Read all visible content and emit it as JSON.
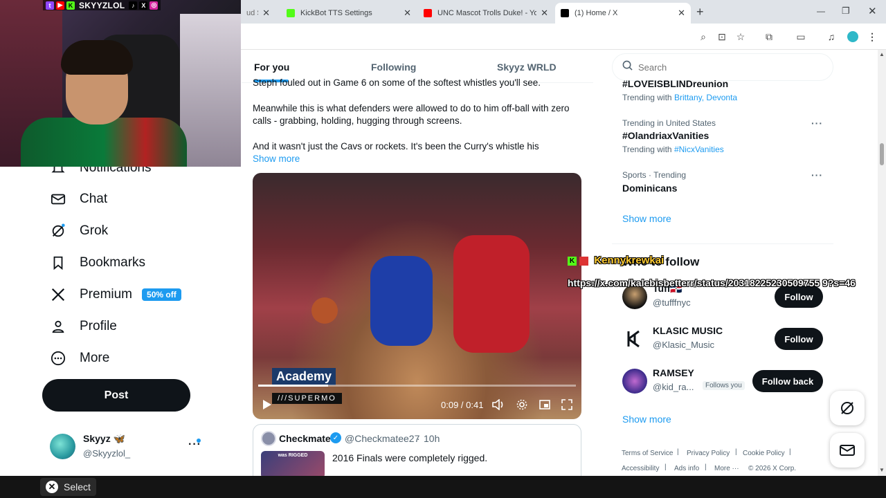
{
  "browser": {
    "tabs": [
      {
        "title": "ud St",
        "active": false,
        "color": "#6b6b6b"
      },
      {
        "title": "KickBot TTS Settings",
        "active": false,
        "color": "#53fc18"
      },
      {
        "title": "UNC Mascot Trolls Duke! - YouTube",
        "active": false,
        "color": "#ff0000"
      },
      {
        "title": "(1) Home / X",
        "active": true,
        "color": "#000000"
      }
    ],
    "new_tab_label": "+",
    "toolbar_icons": [
      "zoom-icon",
      "install-icon",
      "bookmark-star-icon",
      "extensions-icon",
      "cast-icon",
      "media-controls-icon",
      "profile-icon",
      "kebab-menu-icon"
    ]
  },
  "overlay": {
    "handle": "SKYYZLOL",
    "tts_user": "Kennykrewkai",
    "tts_message": "https://x.com/kalebisbetterr/status/20318225230509755 9?s=46"
  },
  "nav": {
    "notifications": "Notifications",
    "chat": "Chat",
    "grok": "Grok",
    "bookmarks": "Bookmarks",
    "premium": "Premium",
    "premium_badge": "50% off",
    "profile": "Profile",
    "more": "More",
    "post": "Post",
    "account_name": "Skyyz 🦋",
    "account_handle": "@Skyyzlol_"
  },
  "main": {
    "tabs": [
      "For you",
      "Following",
      "Skyyz WRLD"
    ],
    "tweet_line0": "Steph fouled out in Game 6 on some of the softest whistles you'll see.",
    "tweet_para1": "Meanwhile this is what defenders were allowed to do to him off-ball with zero calls - grabbing, holding, hugging through screens.",
    "tweet_para2": "And it wasn't just the Cavs or rockets. It's been the Curry's whistle his",
    "show_more": "Show more",
    "video": {
      "logo_top": "Academy",
      "logo_bottom": "///SUPERMO",
      "time": "0:09 / 0:41",
      "progress": 0.22
    },
    "quote": {
      "name": "Checkmate",
      "handle": "@Checkmatee27",
      "age": "10h",
      "text": "2016 Finals were completely rigged.",
      "thumb_label": "was RIGGED"
    }
  },
  "sidebar": {
    "search_placeholder": "Search",
    "trends": [
      {
        "meta": "",
        "name": "#LOVEISBLINDreunion",
        "with_label": "Trending with",
        "with": "Brittany, Devonta"
      },
      {
        "meta": "Trending in United States",
        "name": "#OlandriaxVanities",
        "with_label": "Trending with",
        "with": "#NicxVanities"
      },
      {
        "meta": "Sports · Trending",
        "name": "Dominicans",
        "with_label": "",
        "with": ""
      }
    ],
    "show_more": "Show more",
    "who_to_follow_title": "Who to follow",
    "who_to_follow": [
      {
        "name": "Tuff🇩🇴",
        "handle": "@tufffnyc",
        "button": "Follow",
        "follows_you": ""
      },
      {
        "name": "KLASIC MUSIC",
        "handle": "@Klasic_Music",
        "button": "Follow",
        "follows_you": ""
      },
      {
        "name": "RAMSEY",
        "handle": "@kid_ra...",
        "button": "Follow back",
        "follows_you": "Follows you"
      }
    ],
    "footer": [
      "Terms of Service",
      "Privacy Policy",
      "Cookie Policy",
      "Accessibility",
      "Ads info",
      "More ···",
      "© 2026 X Corp."
    ]
  },
  "bottom": {
    "select_label": "Select"
  },
  "colors": {
    "accent": "#1d9bf0",
    "text": "#0f1419",
    "muted": "#536471"
  }
}
